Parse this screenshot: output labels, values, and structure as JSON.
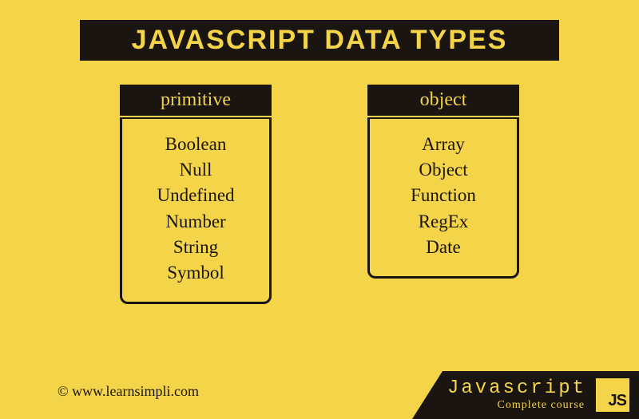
{
  "title": "JAVASCRIPT DATA TYPES",
  "columns": {
    "primitive": {
      "header": "primitive",
      "items": [
        "Boolean",
        "Null",
        "Undefined",
        "Number",
        "String",
        "Symbol"
      ]
    },
    "object": {
      "header": "object",
      "items": [
        "Array",
        "Object",
        "Function",
        "RegEx",
        "Date"
      ]
    }
  },
  "attribution": "© www.learnsimpli.com",
  "footer": {
    "title": "Javascript",
    "subtitle": "Complete course",
    "badge": "JS"
  }
}
